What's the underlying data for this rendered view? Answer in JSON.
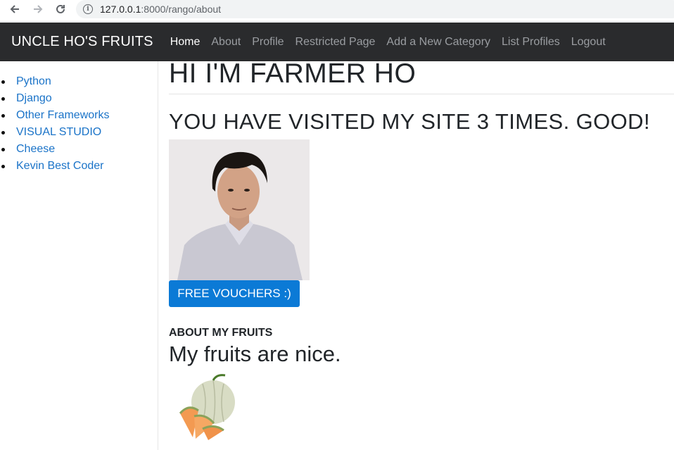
{
  "browser": {
    "url_host": "127.0.0.1",
    "url_path": ":8000/rango/about"
  },
  "navbar": {
    "brand": "UNCLE HO'S FRUITS",
    "links": [
      {
        "label": "Home"
      },
      {
        "label": "About"
      },
      {
        "label": "Profile"
      },
      {
        "label": "Restricted Page"
      },
      {
        "label": "Add a New Category"
      },
      {
        "label": "List Profiles"
      },
      {
        "label": "Logout"
      }
    ]
  },
  "sidebar": {
    "categories": [
      {
        "label": "Python"
      },
      {
        "label": "Django"
      },
      {
        "label": "Other Frameworks"
      },
      {
        "label": "VISUAL STUDIO"
      },
      {
        "label": "Cheese"
      },
      {
        "label": "Kevin Best Coder"
      }
    ]
  },
  "main": {
    "title": "HI I'M FARMER HO",
    "visits": "YOU HAVE VISITED MY SITE 3 TIMES. GOOD!",
    "voucher_button": "FREE VOUCHERS :)",
    "about_heading": "ABOUT MY FRUITS",
    "fruit_text": "My fruits are nice."
  },
  "colors": {
    "navbar_bg": "#2a2b2d",
    "link": "#1a73c8",
    "button": "#0b7ad6"
  }
}
